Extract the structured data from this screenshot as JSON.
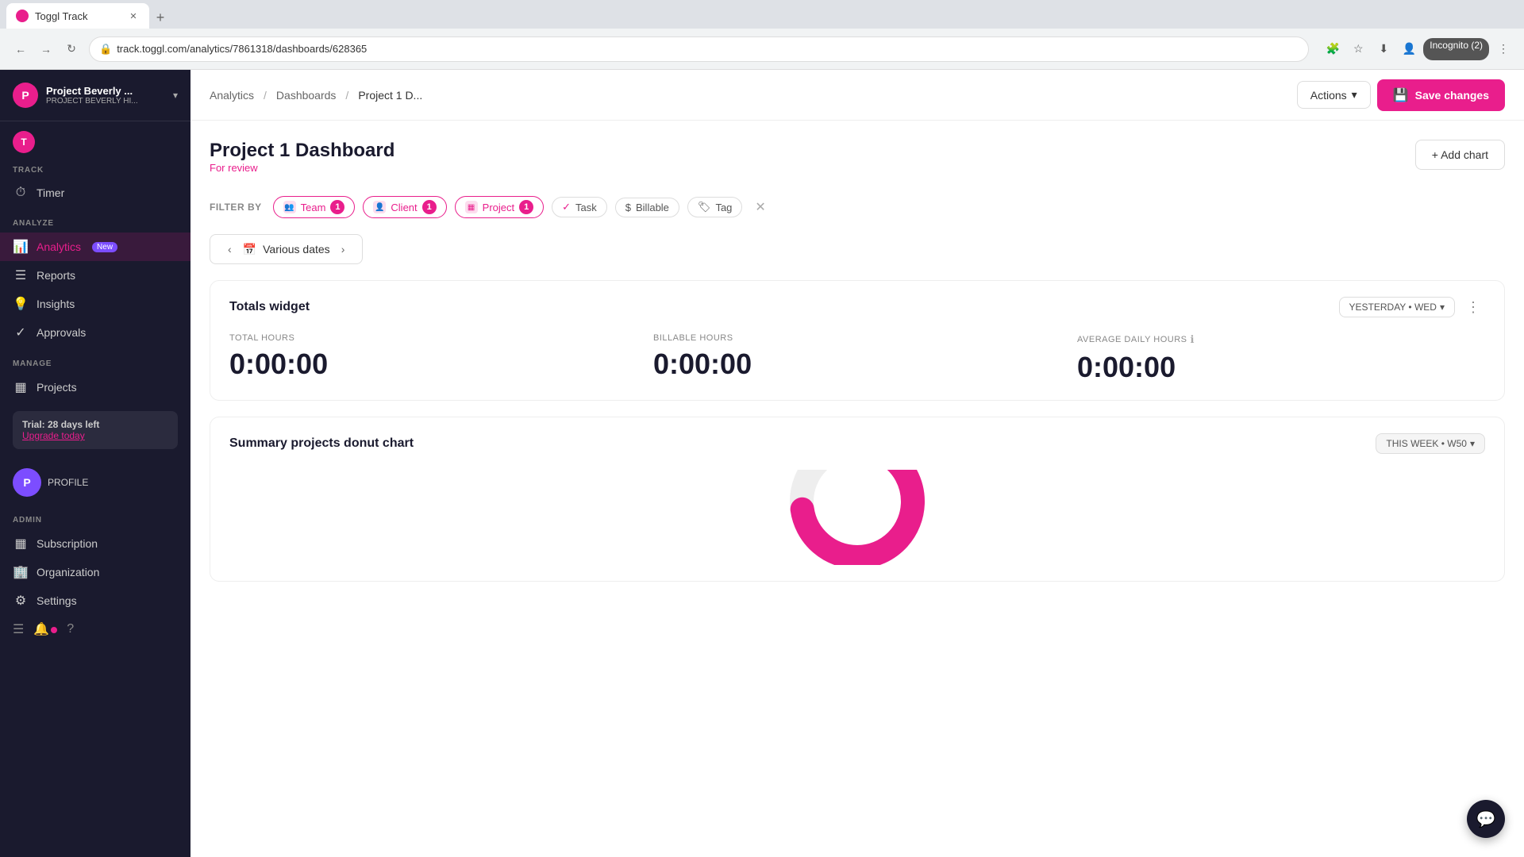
{
  "browser": {
    "tab_title": "Toggl Track",
    "new_tab_label": "+",
    "url": "track.toggl.com/analytics/7861318/dashboards/628365",
    "incognito_label": "Incognito (2)"
  },
  "sidebar": {
    "logo_letter": "P",
    "project_name": "Project Beverly ...",
    "project_sub": "PROJECT BEVERLY HI...",
    "chevron": "▾",
    "track_label": "TRACK",
    "timer_label": "Timer",
    "analyze_label": "ANALYZE",
    "analytics_label": "Analytics",
    "analytics_badge": "New",
    "reports_label": "Reports",
    "insights_label": "Insights",
    "approvals_label": "Approvals",
    "manage_label": "MANAGE",
    "projects_label": "Projects",
    "trial_text": "Trial: 28 days left",
    "upgrade_label": "Upgrade today",
    "admin_label": "ADMIN",
    "subscription_label": "Subscription",
    "organization_label": "Organization",
    "settings_label": "Settings",
    "profile_label": "PROFILE"
  },
  "header": {
    "breadcrumb_analytics": "Analytics",
    "breadcrumb_sep1": "/",
    "breadcrumb_dashboards": "Dashboards",
    "breadcrumb_sep2": "/",
    "breadcrumb_current": "Project 1 D...",
    "actions_label": "Actions",
    "save_changes_label": "Save changes"
  },
  "dashboard": {
    "title": "Project 1 Dashboard",
    "subtitle": "For review",
    "add_chart_label": "+ Add chart",
    "filter_by_label": "FILTER BY",
    "filters": [
      {
        "label": "Team",
        "count": "1",
        "active": true
      },
      {
        "label": "Client",
        "count": "1",
        "active": true
      },
      {
        "label": "Project",
        "count": "1",
        "active": true
      }
    ],
    "filter_plain": [
      {
        "label": "Task"
      },
      {
        "label": "Billable"
      },
      {
        "label": "Tag"
      }
    ],
    "date_picker_label": "Various dates",
    "totals_widget": {
      "title": "Totals widget",
      "date_label": "YESTERDAY • WED",
      "total_hours_label": "TOTAL HOURS",
      "total_hours_value": "0:00:00",
      "billable_hours_label": "BILLABLE HOURS",
      "billable_hours_value": "0:00:00",
      "avg_daily_label": "AVERAGE DAILY HOURS",
      "avg_daily_value": "0:00:00"
    },
    "donut_chart": {
      "title": "Summary projects donut chart",
      "week_label": "THIS WEEK • W50"
    }
  }
}
